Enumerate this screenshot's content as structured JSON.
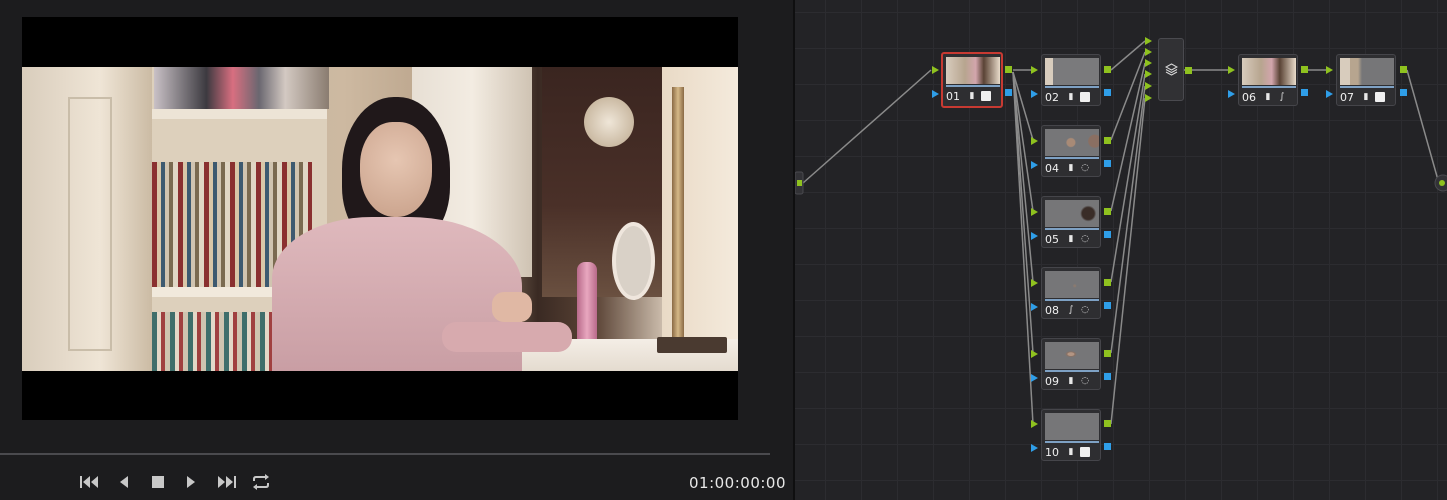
{
  "viewer": {
    "timecode": "01:00:00:00",
    "playhead_progress": 0.0
  },
  "transport": {
    "buttons": [
      {
        "name": "skip-to-start",
        "icon": "skip-back-icon"
      },
      {
        "name": "play-reverse",
        "icon": "play-reverse-icon"
      },
      {
        "name": "stop",
        "icon": "stop-icon"
      },
      {
        "name": "play",
        "icon": "play-icon"
      },
      {
        "name": "skip-to-end",
        "icon": "skip-forward-icon"
      },
      {
        "name": "loop",
        "icon": "loop-icon"
      }
    ]
  },
  "nodes": [
    {
      "id": "01",
      "label": "01",
      "tools": [
        "histogram-icon",
        "check-icon"
      ],
      "selected": true
    },
    {
      "id": "02",
      "label": "02",
      "tools": [
        "histogram-icon",
        "check-icon"
      ]
    },
    {
      "id": "04",
      "label": "04",
      "tools": [
        "histogram-icon",
        "window-icon"
      ]
    },
    {
      "id": "05",
      "label": "05",
      "tools": [
        "histogram-icon",
        "window-icon"
      ]
    },
    {
      "id": "08",
      "label": "08",
      "tools": [
        "curves-icon",
        "window-icon"
      ]
    },
    {
      "id": "09",
      "label": "09",
      "tools": [
        "histogram-icon",
        "window-icon"
      ]
    },
    {
      "id": "10",
      "label": "10",
      "tools": [
        "histogram-icon",
        "check-icon"
      ]
    },
    {
      "id": "06",
      "label": "06",
      "tools": [
        "histogram-icon",
        "curves-icon"
      ]
    },
    {
      "id": "07",
      "label": "07",
      "tools": [
        "histogram-icon",
        "check-icon"
      ]
    }
  ],
  "layer_mixer": {
    "icon": "layers-icon"
  },
  "colors": {
    "selected_border": "#c73a32",
    "rgb_port": "#8fc21f",
    "alpha_port": "#2f9ee8",
    "link": "#8a8a8a"
  }
}
